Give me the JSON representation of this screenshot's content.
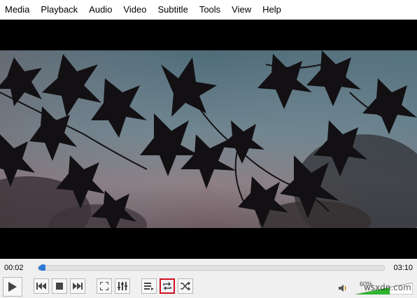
{
  "menubar": {
    "items": [
      "Media",
      "Playback",
      "Audio",
      "Video",
      "Subtitle",
      "Tools",
      "View",
      "Help"
    ]
  },
  "video": {
    "description_icon": "video-frame"
  },
  "timeline": {
    "elapsed": "00:02",
    "total": "03:10",
    "progress_fraction": 0.011
  },
  "controls": {
    "buttons": [
      {
        "name": "play",
        "icon": "play-icon"
      },
      {
        "name": "previous",
        "icon": "previous-icon"
      },
      {
        "name": "stop",
        "icon": "stop-icon"
      },
      {
        "name": "next",
        "icon": "next-icon"
      },
      {
        "name": "fullscreen",
        "icon": "fullscreen-icon"
      },
      {
        "name": "extended-settings",
        "icon": "equalizer-icon"
      },
      {
        "name": "playlist",
        "icon": "playlist-icon"
      },
      {
        "name": "loop",
        "icon": "loop-icon",
        "highlighted": true
      },
      {
        "name": "random",
        "icon": "shuffle-icon"
      }
    ],
    "volume": {
      "percent_label": "60%",
      "level_fraction": 0.6,
      "icon": "speaker-icon"
    }
  },
  "watermark": "wsxdn.com",
  "colors": {
    "accent": "#2e79d6",
    "highlight": "#d30f1f",
    "volume_green": "#2fb52f"
  }
}
